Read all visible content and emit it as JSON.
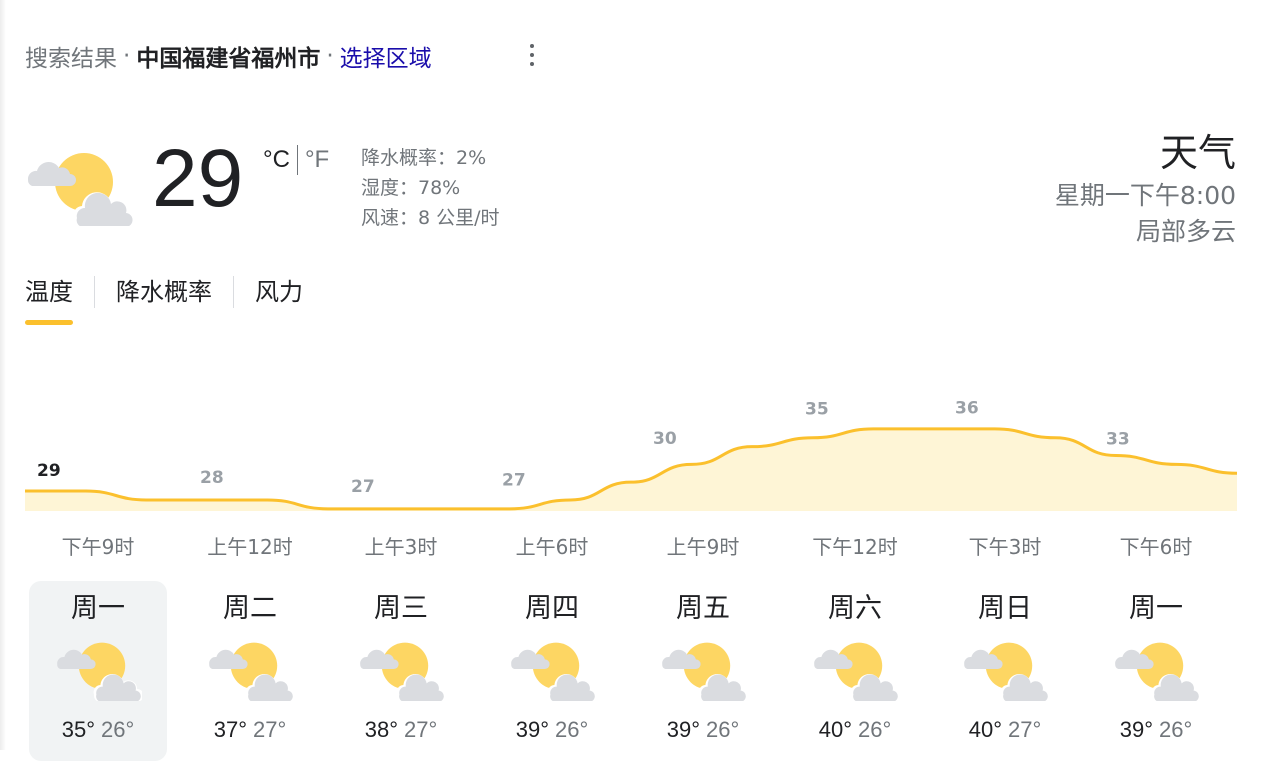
{
  "header": {
    "prefix": "搜索结果",
    "separator": "·",
    "location": "中国福建省福州市",
    "change_region": "选择区域"
  },
  "current": {
    "icon": "partly-cloudy-night-icon",
    "temperature": "29",
    "unit_c": "°C",
    "unit_f": "°F",
    "precip": "降水概率：2%",
    "humidity": "湿度：78%",
    "wind": "风速：8 公里/时"
  },
  "side": {
    "title": "天气",
    "datetime": "星期一下午8:00",
    "condition": "局部多云"
  },
  "tabs": [
    {
      "label": "温度",
      "active": true
    },
    {
      "label": "降水概率",
      "active": false
    },
    {
      "label": "风力",
      "active": false
    }
  ],
  "chart_data": {
    "type": "area",
    "series": [
      {
        "values": [
          29,
          29,
          28,
          28,
          28,
          27,
          27,
          27,
          27,
          28,
          30,
          32,
          34,
          35,
          36,
          36,
          36,
          35,
          33,
          32,
          31
        ]
      }
    ],
    "x": [
      "下午9时",
      "上午12时",
      "上午3时",
      "上午6时",
      "上午9时",
      "下午12时",
      "下午3时",
      "下午6时"
    ],
    "labels": [
      29,
      28,
      27,
      27,
      30,
      35,
      36,
      33
    ],
    "ylim": [
      20,
      37
    ],
    "color": "#fbc02d",
    "fill_color": "#fef5d6"
  },
  "days": [
    {
      "name": "周一",
      "icon": "partly-cloudy-icon",
      "high": "35°",
      "low": "26°",
      "selected": true
    },
    {
      "name": "周二",
      "icon": "partly-cloudy-icon",
      "high": "37°",
      "low": "27°"
    },
    {
      "name": "周三",
      "icon": "partly-cloudy-icon",
      "high": "38°",
      "low": "27°"
    },
    {
      "name": "周四",
      "icon": "partly-cloudy-icon",
      "high": "39°",
      "low": "26°"
    },
    {
      "name": "周五",
      "icon": "partly-cloudy-icon",
      "high": "39°",
      "low": "26°"
    },
    {
      "name": "周六",
      "icon": "partly-cloudy-icon",
      "high": "40°",
      "low": "26°"
    },
    {
      "name": "周日",
      "icon": "partly-cloudy-icon",
      "high": "40°",
      "low": "27°"
    },
    {
      "name": "周一",
      "icon": "partly-cloudy-icon",
      "high": "39°",
      "low": "26°"
    }
  ]
}
